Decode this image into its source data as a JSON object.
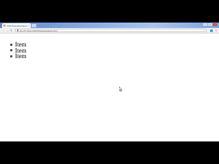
{
  "browser": {
    "tab_title": "CSS Properties Demo",
    "tab_close": "×",
    "controls": {
      "minimize": "–",
      "maximize": "□",
      "close": "×"
    },
    "nav": {
      "back": "←",
      "forward": "→",
      "reload": "↻"
    },
    "address": "file:///C:/Users/WAS/Desktop/default.html",
    "star": "☆",
    "menu": "≡"
  },
  "page": {
    "items": [
      {
        "label": "Item"
      },
      {
        "label": "Item"
      },
      {
        "label": "Item"
      }
    ]
  },
  "colors": {
    "page_background": "#ffffff",
    "letterbox": "#000000",
    "tab_strip": "#8cb0e6"
  }
}
